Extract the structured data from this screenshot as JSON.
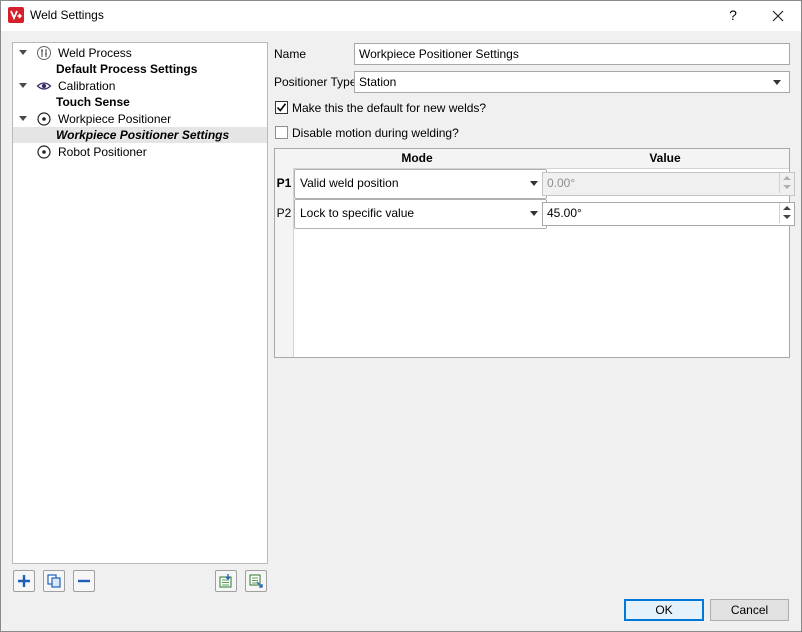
{
  "window": {
    "title": "Weld Settings",
    "help_label": "?"
  },
  "tree": {
    "items": [
      {
        "label": "Weld Process",
        "icon": "weld-process-icon",
        "child": "Default Process Settings",
        "child_italic": false
      },
      {
        "label": "Calibration",
        "icon": "eye-icon",
        "child": "Touch Sense",
        "child_italic": false
      },
      {
        "label": "Workpiece Positioner",
        "icon": "positioner-icon",
        "child": "Workpiece Positioner Settings",
        "child_italic": true,
        "child_selected": true
      },
      {
        "label": "Robot Positioner",
        "icon": "positioner-icon"
      }
    ],
    "toolbar": [
      "add-icon",
      "duplicate-icon",
      "remove-icon",
      "import-icon",
      "export-icon"
    ]
  },
  "form": {
    "name_label": "Name",
    "name_value": "Workpiece Positioner Settings",
    "positioner_type_label": "Positioner Type",
    "positioner_type_value": "Station",
    "default_checkbox_label": "Make this the default for new welds?",
    "default_checked": true,
    "disable_motion_label": "Disable motion during welding?",
    "disable_motion_checked": false
  },
  "table": {
    "headers": {
      "mode": "Mode",
      "value": "Value"
    },
    "rows": [
      {
        "id": "P1",
        "mode": "Valid weld position",
        "value": "0.00°",
        "disabled": true
      },
      {
        "id": "P2",
        "mode": "Lock to specific value",
        "value": "45.00°",
        "disabled": false
      }
    ]
  },
  "buttons": {
    "ok": "OK",
    "cancel": "Cancel"
  },
  "colors": {
    "accent": "#0078d7",
    "app_icon": "#d4202a"
  }
}
